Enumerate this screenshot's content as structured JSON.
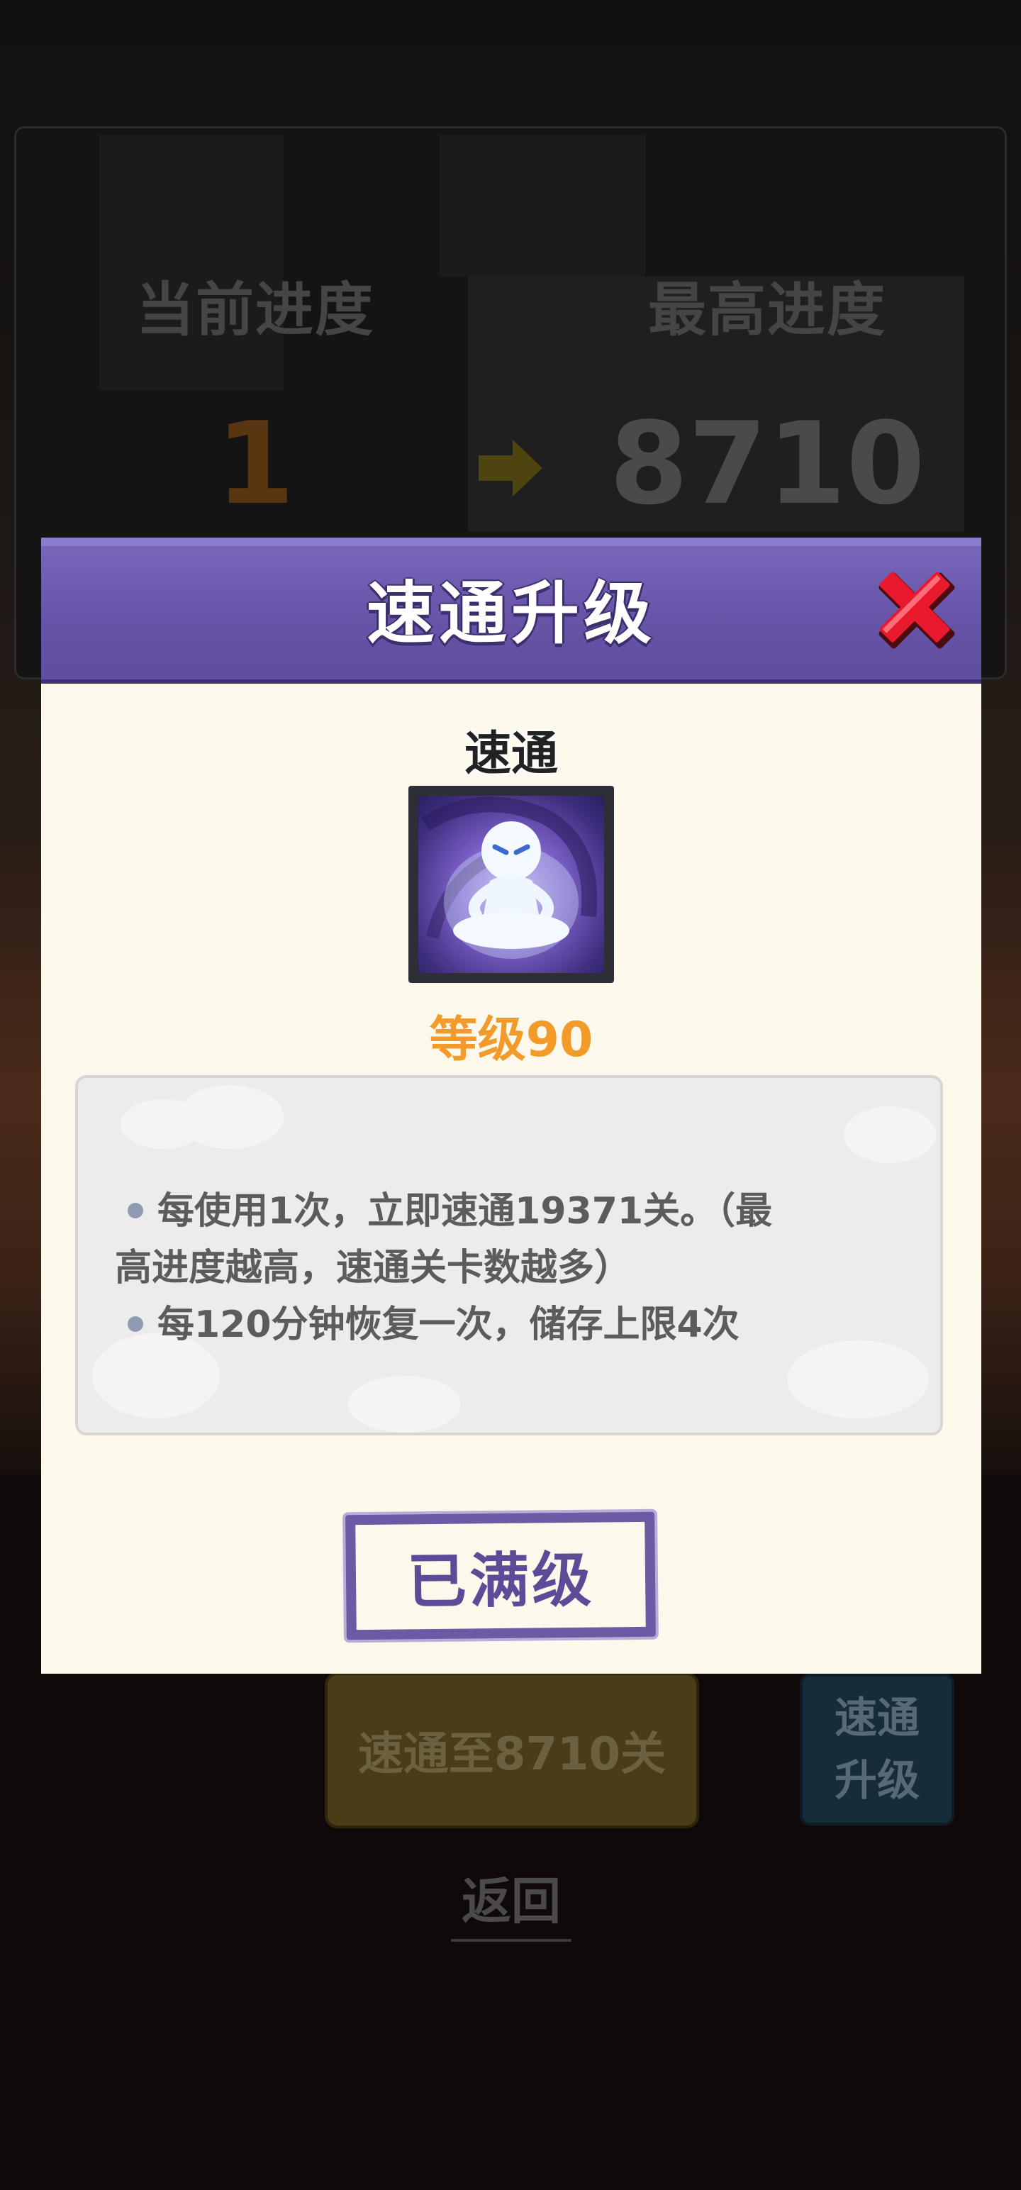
{
  "background": {
    "current_progress_label": "当前进度",
    "highest_progress_label": "最高进度",
    "current_progress_value": "1",
    "highest_progress_value": "8710",
    "quick_pass_button_label": "速通至8710关",
    "upgrade_button_line1": "速通",
    "upgrade_button_line2": "升级",
    "back_label": "返回"
  },
  "dialog": {
    "title": "速通升级",
    "skill_name": "速通",
    "skill_icon": "meditating-spirit-icon",
    "level_text": "等级90",
    "description": {
      "line1": "每使用1次，立即速通19371关。（最",
      "line2": "高进度越高，速通关卡数越多）",
      "line3": "每120分钟恢复一次，储存上限4次"
    },
    "maxed_button_label": "已满级"
  },
  "colors": {
    "header_purple": "#6854a8",
    "body_cream": "#fdf8ec",
    "level_orange": "#f29b2a",
    "close_red": "#e8192c"
  }
}
